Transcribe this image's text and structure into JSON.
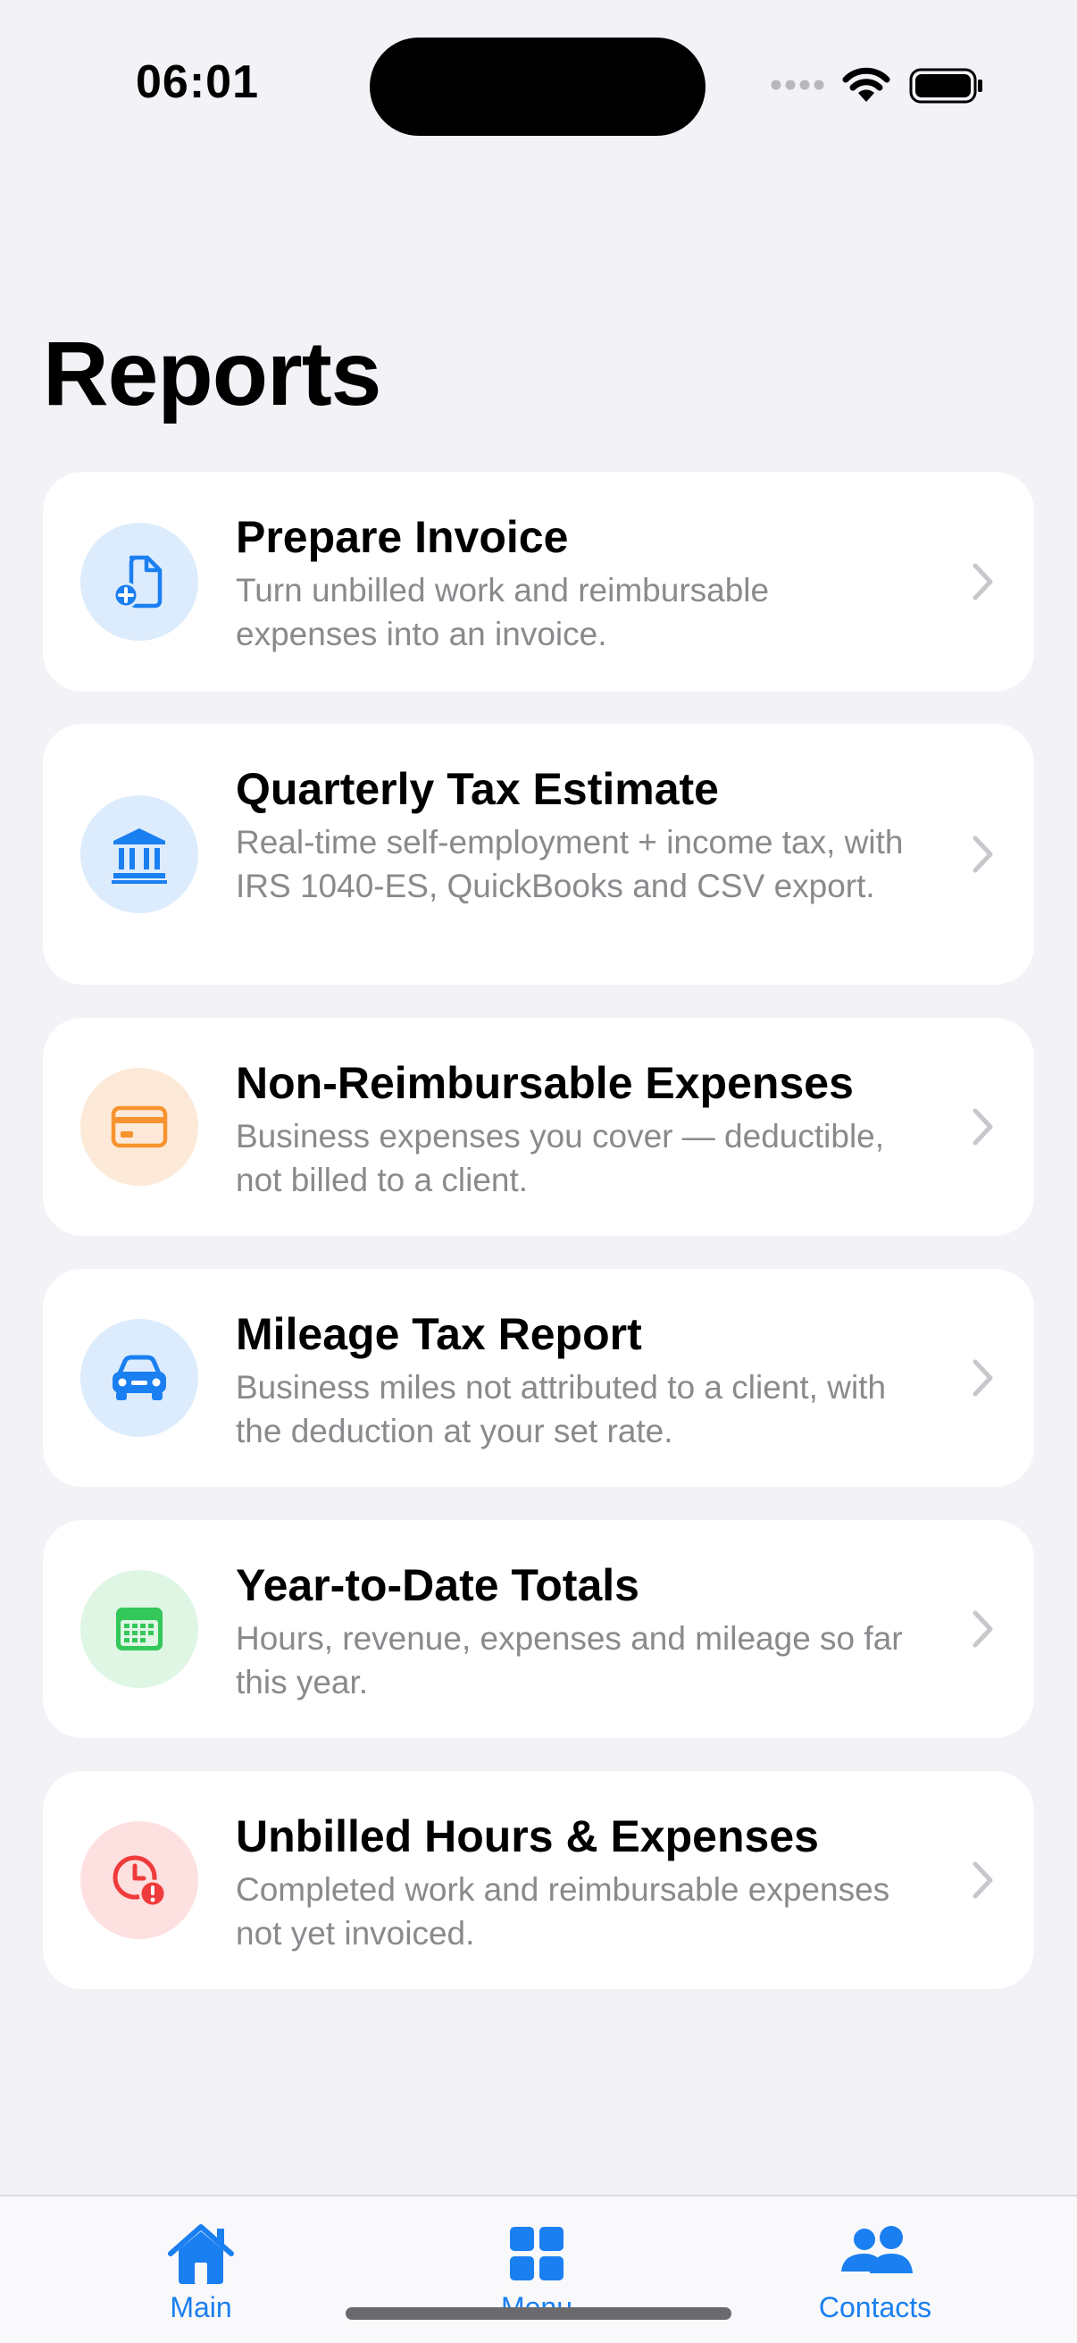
{
  "status_bar": {
    "time": "06:01",
    "icons": [
      "cellular-signal-icon",
      "wifi-icon",
      "battery-icon"
    ]
  },
  "page": {
    "title": "Reports"
  },
  "reports": [
    {
      "title": "Prepare Invoice",
      "description": "Turn unbilled work and reimbursable expenses into an invoice.",
      "icon": "invoice-add-icon",
      "icon_color": "#1a7ff0",
      "icon_bg": "#dcecfd"
    },
    {
      "title": "Quarterly Tax Estimate",
      "description": "Real-time self-employment + income tax, with IRS 1040-ES, QuickBooks and CSV export.",
      "icon": "bank-icon",
      "icon_color": "#1a7ff0",
      "icon_bg": "#dcecfd"
    },
    {
      "title": "Non-Reimbursable Expenses",
      "description": "Business expenses you cover — deductible, not billed to a client.",
      "icon": "credit-card-icon",
      "icon_color": "#f7932e",
      "icon_bg": "#fde9d8"
    },
    {
      "title": "Mileage Tax Report",
      "description": "Business miles not attributed to a client, with the deduction at your set rate.",
      "icon": "car-icon",
      "icon_color": "#1a7ff0",
      "icon_bg": "#dcecfd"
    },
    {
      "title": "Year-to-Date Totals",
      "description": "Hours, revenue, expenses and mileage so far this year.",
      "icon": "calendar-icon",
      "icon_color": "#34c759",
      "icon_bg": "#def6e3"
    },
    {
      "title": "Unbilled Hours & Expenses",
      "description": "Completed work and reimbursable expenses not yet invoiced.",
      "icon": "clock-alert-icon",
      "icon_color": "#ef3b3b",
      "icon_bg": "#fde0e0"
    }
  ],
  "tab_bar": {
    "tabs": [
      {
        "label": "Main",
        "icon": "home-icon"
      },
      {
        "label": "Menu",
        "icon": "grid-icon"
      },
      {
        "label": "Contacts",
        "icon": "people-icon"
      }
    ],
    "accent_color": "#1a7ff0"
  },
  "colors": {
    "background": "#f2f2f7",
    "card": "#ffffff",
    "secondary_text": "#8a8a8e",
    "chevron": "#c7c7cc"
  }
}
